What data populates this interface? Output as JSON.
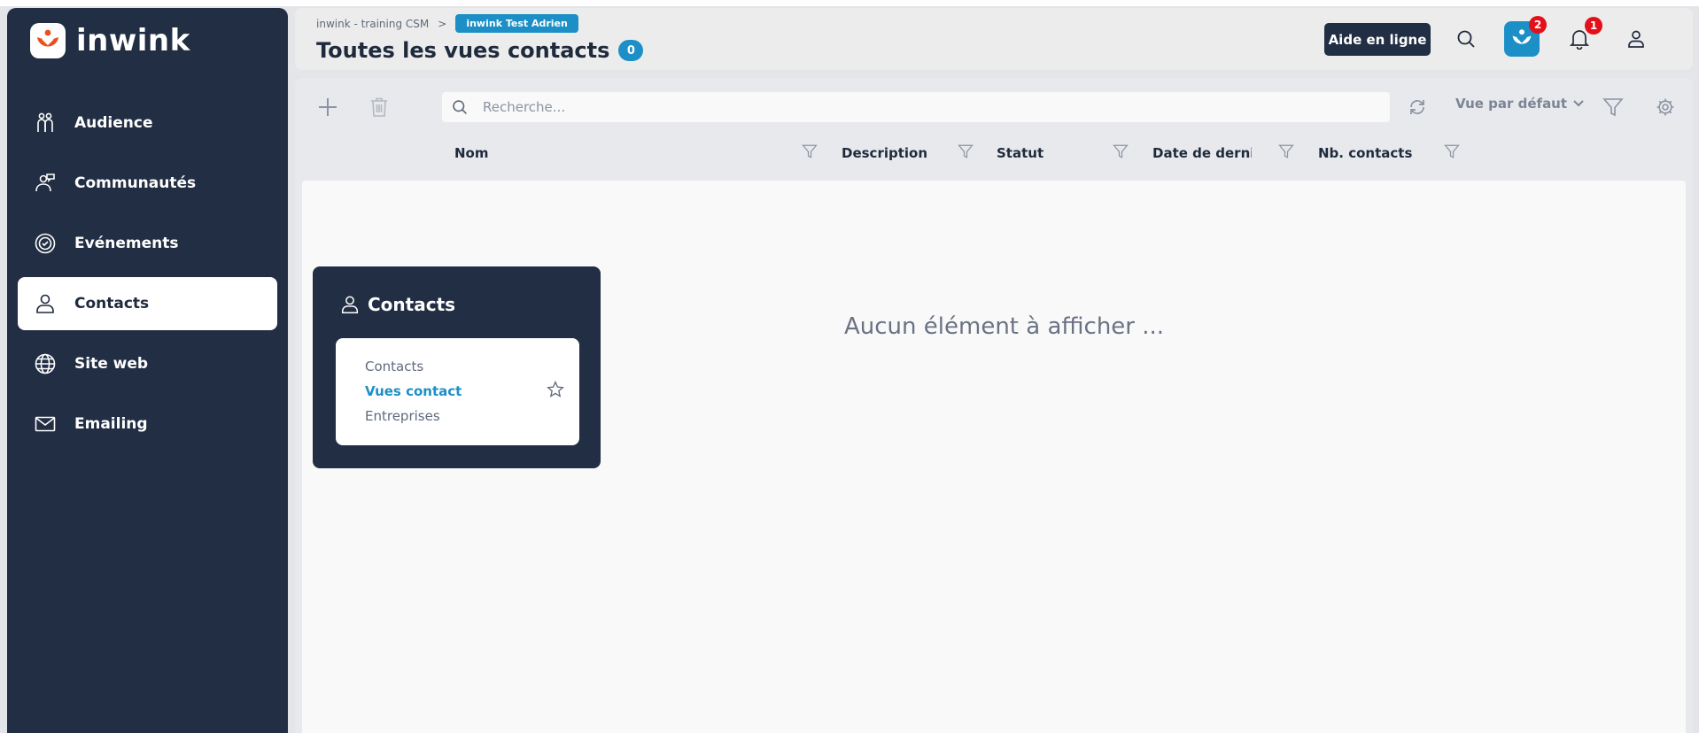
{
  "app": {
    "brand": "inwink",
    "brand_color": "#222e43",
    "accent_color": "#1c90c6",
    "logo_color": "#e8501c"
  },
  "sidebar": {
    "items": [
      {
        "label": "Audience",
        "icon": "audience-icon",
        "active": false
      },
      {
        "label": "Communautés",
        "icon": "community-icon",
        "active": false
      },
      {
        "label": "Evénements",
        "icon": "events-icon",
        "active": false
      },
      {
        "label": "Contacts",
        "icon": "contact-user-icon",
        "active": true
      },
      {
        "label": "Site web",
        "icon": "globe-icon",
        "active": false
      },
      {
        "label": "Emailing",
        "icon": "envelope-icon",
        "active": false
      }
    ]
  },
  "header": {
    "breadcrumb": {
      "parent": "inwink - training CSM",
      "separator": ">",
      "current": "inwink Test Adrien"
    },
    "title": "Toutes les vues contacts",
    "count": "0",
    "help_label": "Aide en ligne",
    "app_badge": "2",
    "bell_badge": "1"
  },
  "toolbar": {
    "search_placeholder": "Recherche...",
    "view_label": "Vue par défaut"
  },
  "table": {
    "columns": [
      "Nom",
      "Description",
      "Statut",
      "Date de derniè",
      "Nb. contacts"
    ],
    "empty_message": "Aucun élément à afficher ..."
  },
  "flyout": {
    "title": "Contacts",
    "items": [
      {
        "label": "Contacts",
        "active": false
      },
      {
        "label": "Vues contact",
        "active": true
      },
      {
        "label": "Entreprises",
        "active": false
      }
    ]
  },
  "notification_color": "#e3101a"
}
